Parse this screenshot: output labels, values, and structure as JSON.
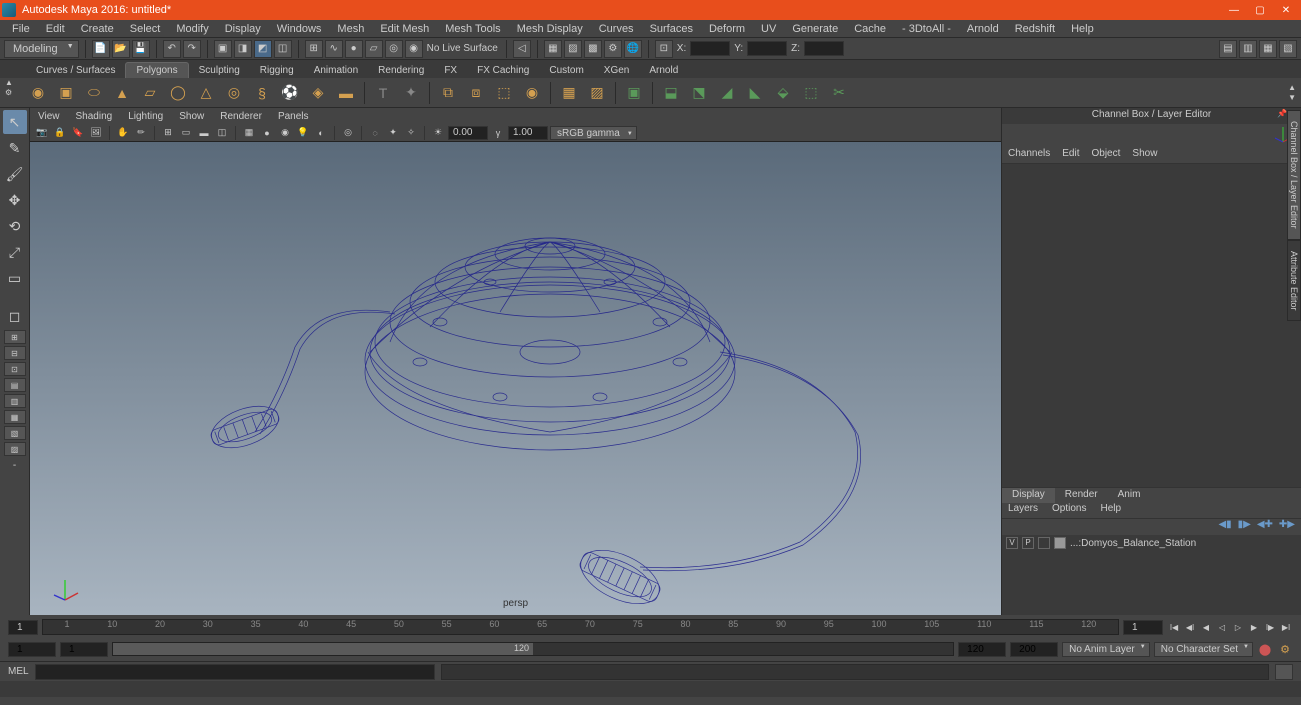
{
  "title": "Autodesk Maya 2016: untitled*",
  "menus": [
    "File",
    "Edit",
    "Create",
    "Select",
    "Modify",
    "Display",
    "Windows",
    "Mesh",
    "Edit Mesh",
    "Mesh Tools",
    "Mesh Display",
    "Curves",
    "Surfaces",
    "Deform",
    "UV",
    "Generate",
    "Cache",
    "- 3DtoAll -",
    "Arnold",
    "Redshift",
    "Help"
  ],
  "workspace": "Modeling",
  "toolbar": {
    "no_live_surface": "No Live Surface",
    "x": "X:",
    "y": "Y:",
    "z": "Z:"
  },
  "shelf_tabs": [
    "Curves / Surfaces",
    "Polygons",
    "Sculpting",
    "Rigging",
    "Animation",
    "Rendering",
    "FX",
    "FX Caching",
    "Custom",
    "XGen",
    "Arnold"
  ],
  "shelf_active": 1,
  "view_menus": [
    "View",
    "Shading",
    "Lighting",
    "Show",
    "Renderer",
    "Panels"
  ],
  "view_toolbar": {
    "exposure": "0.00",
    "gamma": "1.00",
    "colorspace": "sRGB gamma"
  },
  "persp_label": "persp",
  "channel_box": {
    "title": "Channel Box / Layer Editor",
    "menus": [
      "Channels",
      "Edit",
      "Object",
      "Show"
    ]
  },
  "layer_tabs": [
    "Display",
    "Render",
    "Anim"
  ],
  "layer_menus": [
    "Layers",
    "Options",
    "Help"
  ],
  "layer_item": "...:Domyos_Balance_Station",
  "layer_v": "V",
  "layer_p": "P",
  "timeline": {
    "start_vis": "1",
    "current": "1",
    "end_vis": "120",
    "start_range": "1",
    "end_range": "200",
    "no_anim_layer": "No Anim Layer",
    "no_char_set": "No Character Set",
    "ticks": [
      "1",
      "10",
      "20",
      "30",
      "35",
      "40",
      "45",
      "50",
      "55",
      "60",
      "65",
      "70",
      "75",
      "80",
      "85",
      "90",
      "95",
      "100",
      "105",
      "110",
      "115",
      "120"
    ]
  },
  "cmd": {
    "label": "MEL"
  },
  "side_tabs": [
    "Channel Box / Layer Editor",
    "Attribute Editor"
  ]
}
